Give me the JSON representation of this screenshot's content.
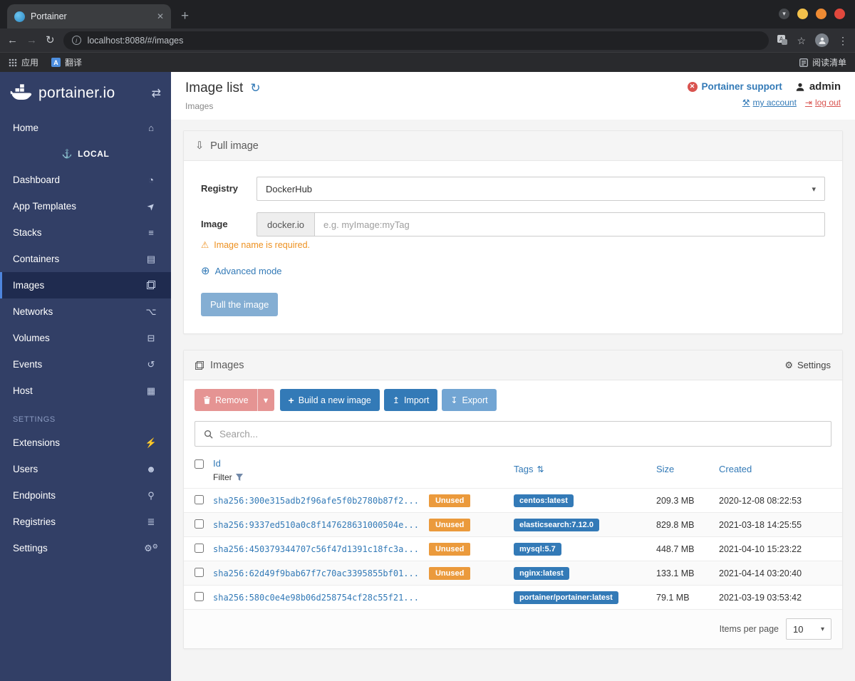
{
  "colors": {
    "primary": "#337ab7",
    "sidebar_bg": "#323f66",
    "sidebar_active": "#1f2b4f",
    "unused_badge": "#eb9a3c",
    "danger_muted": "#e59493",
    "support_red": "#d9534f",
    "export_muted": "#72a5d3",
    "pull_disabled": "#84aed3"
  },
  "icons": {
    "back": "←",
    "forward": "→",
    "reload": "↻",
    "star": "☆",
    "menu": "⋮",
    "caret_down": "▾",
    "close": "✕",
    "new_tab": "+",
    "window_caret": "▾",
    "collapse": "⇄",
    "home": "⌂",
    "anchor": "⚓",
    "dashboard": "◔",
    "app_templates": "➤",
    "stacks": "≡",
    "containers": "▤",
    "networks": "⌥",
    "volumes": "⊟",
    "events": "↺",
    "host": "▦",
    "extensions": "⚡",
    "users": "☻",
    "endpoints": "⚲",
    "registries": "≣",
    "gear": "⚙",
    "refresh": "↻",
    "wrench": "⚒",
    "logout": "⇥",
    "download": "⇩",
    "warning": "⚠",
    "globe": "⊕",
    "upload": "↥",
    "export": "↧",
    "plus": "+",
    "sort": "⇅",
    "info": "i",
    "support_x": "✕",
    "translate_letter": "A"
  },
  "browser": {
    "tab_title": "Portainer",
    "url": "localhost:8088/#/images",
    "bookmarks": {
      "apps": "应用",
      "translate": "翻译",
      "reading_list": "阅读清单"
    }
  },
  "sidebar": {
    "logo_text": "portainer.io",
    "local_header": "LOCAL",
    "settings_header": "SETTINGS",
    "items": [
      {
        "label": "Home"
      },
      {
        "label": "Dashboard"
      },
      {
        "label": "App Templates"
      },
      {
        "label": "Stacks"
      },
      {
        "label": "Containers"
      },
      {
        "label": "Images"
      },
      {
        "label": "Networks"
      },
      {
        "label": "Volumes"
      },
      {
        "label": "Events"
      },
      {
        "label": "Host"
      },
      {
        "label": "Extensions"
      },
      {
        "label": "Users"
      },
      {
        "label": "Endpoints"
      },
      {
        "label": "Registries"
      },
      {
        "label": "Settings"
      }
    ]
  },
  "header": {
    "title": "Image list",
    "subtitle": "Images",
    "support": "Portainer support",
    "user": "admin",
    "my_account": "my account",
    "log_out": "log out"
  },
  "pull": {
    "title": "Pull image",
    "registry_label": "Registry",
    "registry_value": "DockerHub",
    "image_label": "Image",
    "image_prefix": "docker.io",
    "image_placeholder": "e.g. myImage:myTag",
    "warning": "Image name is required.",
    "advanced": "Advanced mode",
    "button": "Pull the image"
  },
  "images": {
    "title": "Images",
    "settings": "Settings",
    "remove": "Remove",
    "build": "Build a new image",
    "import": "Import",
    "export": "Export",
    "search_placeholder": "Search...",
    "col_id": "Id",
    "filter": "Filter",
    "col_tags": "Tags",
    "col_size": "Size",
    "col_created": "Created",
    "items_per_page": "Items per page",
    "page_size": "10",
    "rows": [
      {
        "id": "sha256:300e315adb2f96afe5f0b2780b87f2...",
        "unused": "Unused",
        "tag": "centos:latest",
        "size": "209.3 MB",
        "created": "2020-12-08 08:22:53"
      },
      {
        "id": "sha256:9337ed510a0c8f147628631000504e...",
        "unused": "Unused",
        "tag": "elasticsearch:7.12.0",
        "size": "829.8 MB",
        "created": "2021-03-18 14:25:55"
      },
      {
        "id": "sha256:450379344707c56f47d1391c18fc3a...",
        "unused": "Unused",
        "tag": "mysql:5.7",
        "size": "448.7 MB",
        "created": "2021-04-10 15:23:22"
      },
      {
        "id": "sha256:62d49f9bab67f7c70ac3395855bf01...",
        "unused": "Unused",
        "tag": "nginx:latest",
        "size": "133.1 MB",
        "created": "2021-04-14 03:20:40"
      },
      {
        "id": "sha256:580c0e4e98b06d258754cf28c55f21...",
        "unused": "",
        "tag": "portainer/portainer:latest",
        "size": "79.1 MB",
        "created": "2021-03-19 03:53:42"
      }
    ]
  }
}
